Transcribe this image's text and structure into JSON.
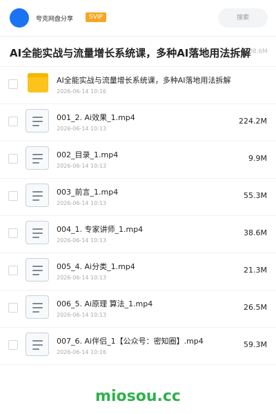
{
  "header": {
    "sharer_name": "夸克网盘分享",
    "badge": "SVIP",
    "search_label": "搜索"
  },
  "folder": {
    "title": "AI全能实战与流量增长系统课，多种AI落地用法拆解",
    "total_size": "708.6M"
  },
  "items": [
    {
      "type": "folder",
      "name": "AI全能实战与流量增长系统课，多种AI落地用法拆解",
      "date": "2026-06-14 10:16",
      "size": ""
    },
    {
      "type": "file",
      "name": "001_2. Ai效果_1.mp4",
      "date": "2026-06-14 10:13",
      "size": "224.2M"
    },
    {
      "type": "file",
      "name": "002_目录_1.mp4",
      "date": "2026-06-14 10:13",
      "size": "9.9M"
    },
    {
      "type": "file",
      "name": "003_前言_1.mp4",
      "date": "2026-06-14 10:13",
      "size": "55.3M"
    },
    {
      "type": "file",
      "name": "004_1. 专家讲师_1.mp4",
      "date": "2026-06-14 10:13",
      "size": "38.6M"
    },
    {
      "type": "file",
      "name": "005_4. Ai分类_1.mp4",
      "date": "2026-06-14 10:13",
      "size": "21.3M"
    },
    {
      "type": "file",
      "name": "006_5. Ai原理 算法_1.mp4",
      "date": "2026-06-14 10:13",
      "size": "26.5M"
    },
    {
      "type": "file",
      "name": "007_6. Ai伴侣_1【公众号：密知圈】.mp4",
      "date": "2026-06-14 10:16",
      "size": "59.3M"
    }
  ],
  "watermark": "miosou.cc",
  "colors": {
    "accent": "#1a73f3",
    "badge": "#f5a623",
    "folder": "#fcc31d",
    "watermark": "#2fb14a"
  }
}
